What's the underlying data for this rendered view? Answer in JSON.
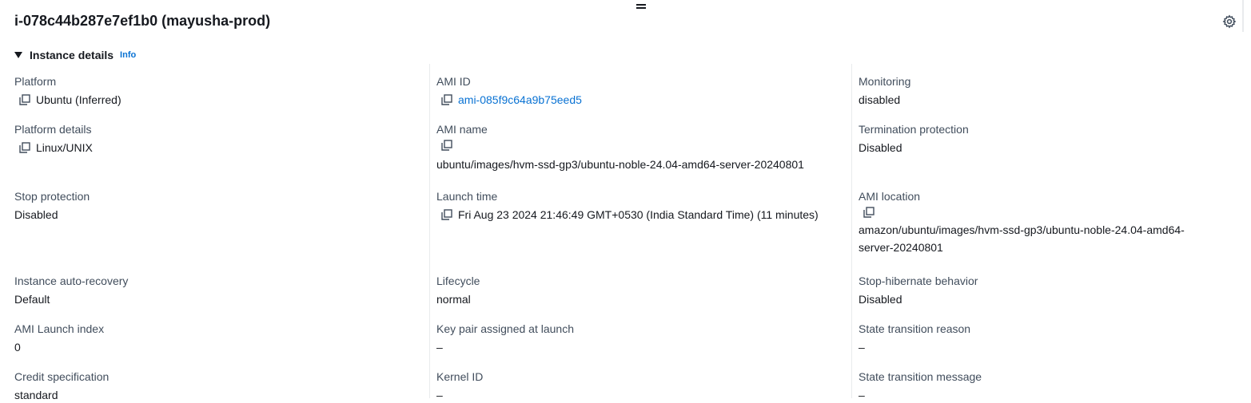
{
  "header": {
    "title": "i-078c44b287e7ef1b0 (mayusha-prod)",
    "settings_icon": "gear-icon"
  },
  "section": {
    "title": "Instance details",
    "info": "Info"
  },
  "fields": {
    "platform": {
      "label": "Platform",
      "value": "Ubuntu (Inferred)"
    },
    "platform_details": {
      "label": "Platform details",
      "value": "Linux/UNIX"
    },
    "stop_protection": {
      "label": "Stop protection",
      "value": "Disabled"
    },
    "auto_recovery": {
      "label": "Instance auto-recovery",
      "value": "Default"
    },
    "ami_launch_index": {
      "label": "AMI Launch index",
      "value": "0"
    },
    "credit_spec": {
      "label": "Credit specification",
      "value": "standard"
    },
    "ami_id": {
      "label": "AMI ID",
      "value": "ami-085f9c64a9b75eed5"
    },
    "ami_name": {
      "label": "AMI name",
      "value": "ubuntu/images/hvm-ssd-gp3/ubuntu-noble-24.04-amd64-server-20240801"
    },
    "launch_time": {
      "label": "Launch time",
      "value": "Fri Aug 23 2024 21:46:49 GMT+0530 (India Standard Time) (11 minutes)"
    },
    "lifecycle": {
      "label": "Lifecycle",
      "value": "normal"
    },
    "key_pair": {
      "label": "Key pair assigned at launch",
      "value": "–"
    },
    "kernel_id": {
      "label": "Kernel ID",
      "value": "–"
    },
    "monitoring": {
      "label": "Monitoring",
      "value": "disabled"
    },
    "termination_protection": {
      "label": "Termination protection",
      "value": "Disabled"
    },
    "ami_location": {
      "label": "AMI location",
      "value_line1": "amazon/ubuntu/images/hvm-ssd-gp3/ubuntu-noble-24.04-amd64-",
      "value_line2": "server-20240801"
    },
    "stop_hibernate": {
      "label": "Stop-hibernate behavior",
      "value": "Disabled"
    },
    "state_transition_reason": {
      "label": "State transition reason",
      "value": "–"
    },
    "state_transition_message": {
      "label": "State transition message",
      "value": "–"
    }
  },
  "colors": {
    "link": "#0972d3",
    "text": "#16191f",
    "label": "#414d5c",
    "divider": "#e9ebed"
  }
}
